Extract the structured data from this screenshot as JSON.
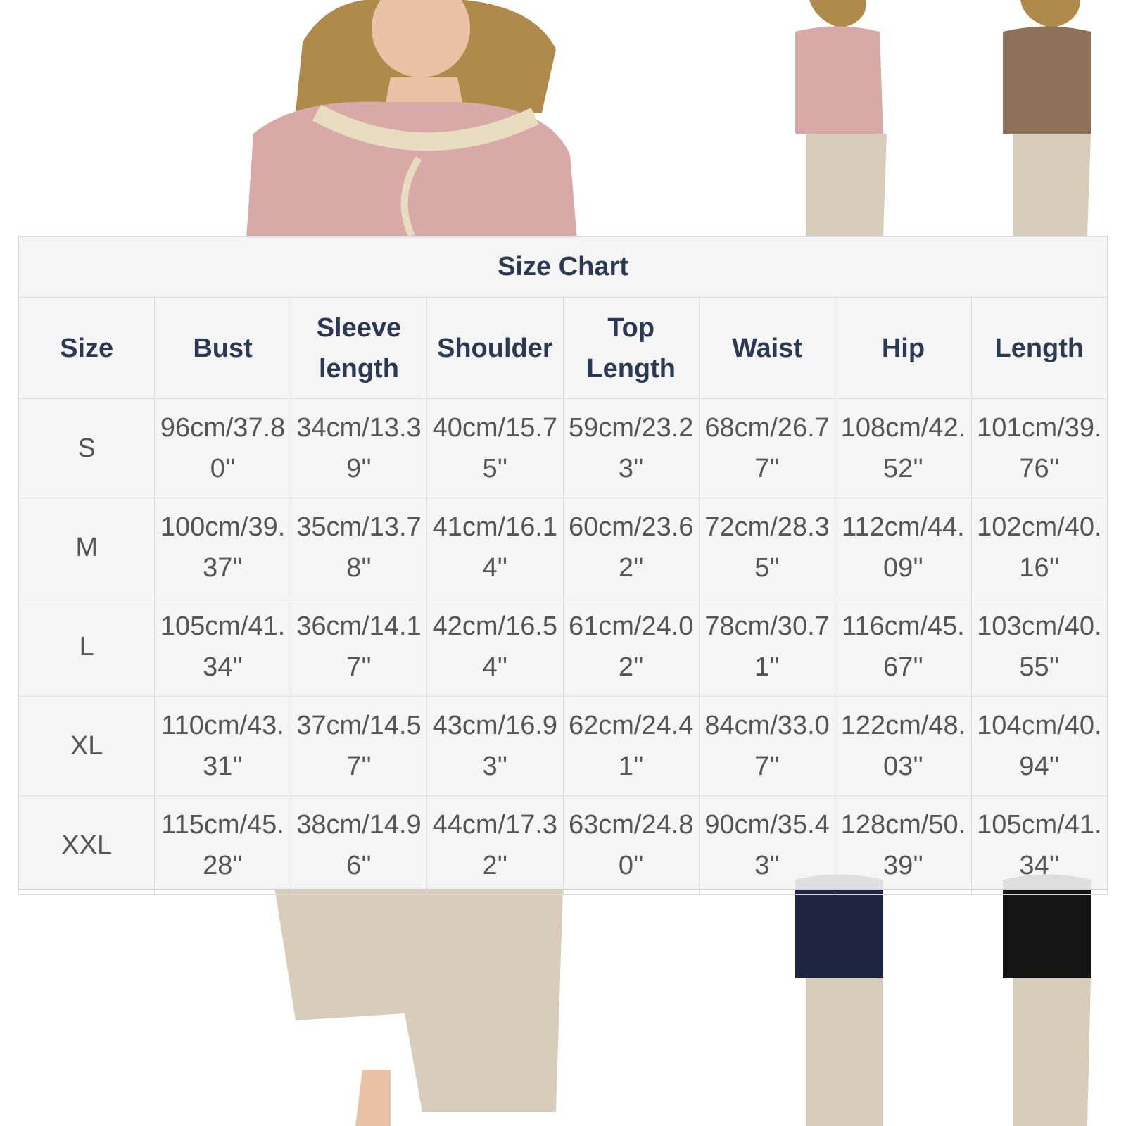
{
  "chart_data": {
    "type": "table",
    "title": "Size Chart",
    "columns": [
      "Size",
      "Bust",
      "Sleeve length",
      "Shoulder",
      "Top Length",
      "Waist",
      "Hip",
      "Length"
    ],
    "rows": [
      [
        "S",
        "96cm/37.80''",
        "34cm/13.39''",
        "40cm/15.75''",
        "59cm/23.23''",
        "68cm/26.77''",
        "108cm/42.52''",
        "101cm/39.76''"
      ],
      [
        "M",
        "100cm/39.37''",
        "35cm/13.78''",
        "41cm/16.14''",
        "60cm/23.62''",
        "72cm/28.35''",
        "112cm/44.09''",
        "102cm/40.16''"
      ],
      [
        "L",
        "105cm/41.34''",
        "36cm/14.17''",
        "42cm/16.54''",
        "61cm/24.02''",
        "78cm/30.71''",
        "116cm/45.67''",
        "103cm/40.55''"
      ],
      [
        "XL",
        "110cm/43.31''",
        "37cm/14.57''",
        "43cm/16.93''",
        "62cm/24.41''",
        "84cm/33.07''",
        "122cm/48.03''",
        "104cm/40.94''"
      ],
      [
        "XXL",
        "115cm/45.28''",
        "38cm/14.96''",
        "44cm/17.32''",
        "63cm/24.80''",
        "90cm/35.43''",
        "128cm/50.39''",
        "105cm/41.34''"
      ]
    ]
  },
  "colors": {
    "header_text": "#2b3a52",
    "cell_text": "#555555",
    "table_bg": "#f4f4f5",
    "blouse_pink": "#d9a9a8",
    "blouse_brown": "#8d7158",
    "blouse_navy": "#1e2540",
    "blouse_black": "#141414",
    "pants_beige": "#d8cdbb",
    "hair": "#b08a4a"
  }
}
